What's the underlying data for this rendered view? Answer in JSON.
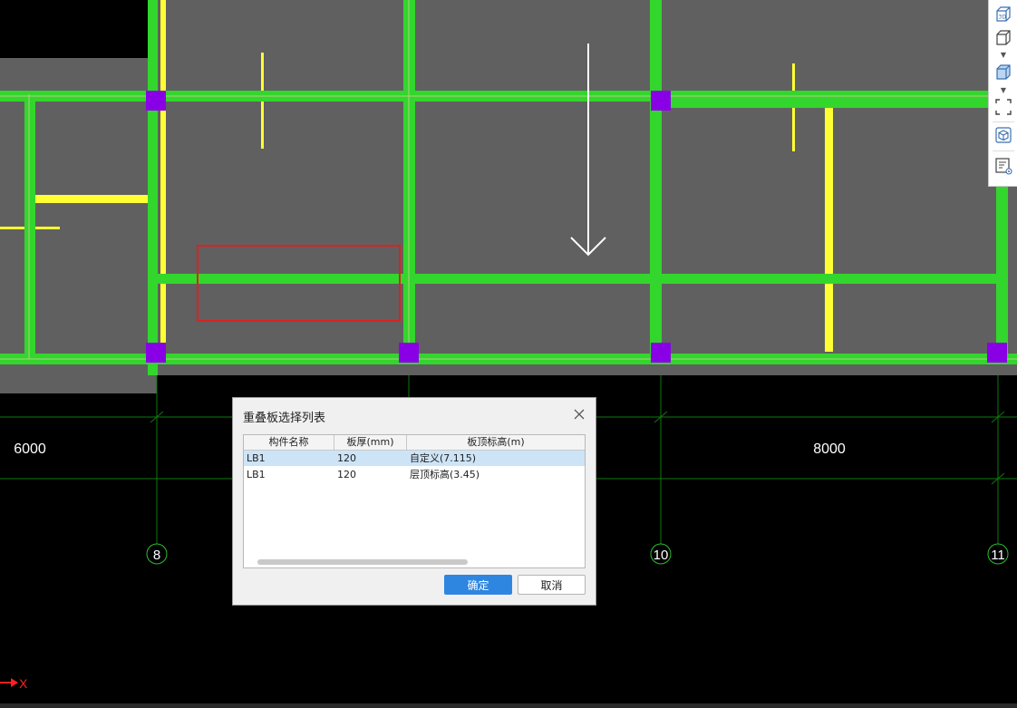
{
  "canvas": {
    "dimensions": [
      "6000",
      "8000"
    ],
    "axis_labels": [
      "8",
      "10",
      "11"
    ],
    "x_axis_label": "X"
  },
  "toolbar": {
    "items": [
      "3d-view-icon",
      "box-wireframe-icon",
      "box-solid-icon",
      "fullscreen-icon",
      "cube-outline-icon",
      "display-settings-icon"
    ]
  },
  "dialog": {
    "title": "重叠板选择列表",
    "columns": [
      "构件名称",
      "板厚(mm)",
      "板顶标高(m)"
    ],
    "rows": [
      {
        "name": "LB1",
        "thickness": "120",
        "elevation": "自定义(7.115)"
      },
      {
        "name": "LB1",
        "thickness": "120",
        "elevation": "层顶标高(3.45)"
      }
    ],
    "ok_label": "确定",
    "cancel_label": "取消"
  },
  "colors": {
    "beam": "#33d62c",
    "column": "#8a00e6",
    "rebar": "#ffff33",
    "slab": "#606060",
    "grid": "#0e7a0e",
    "selection": "#e02020",
    "accent": "#2f86e0"
  }
}
